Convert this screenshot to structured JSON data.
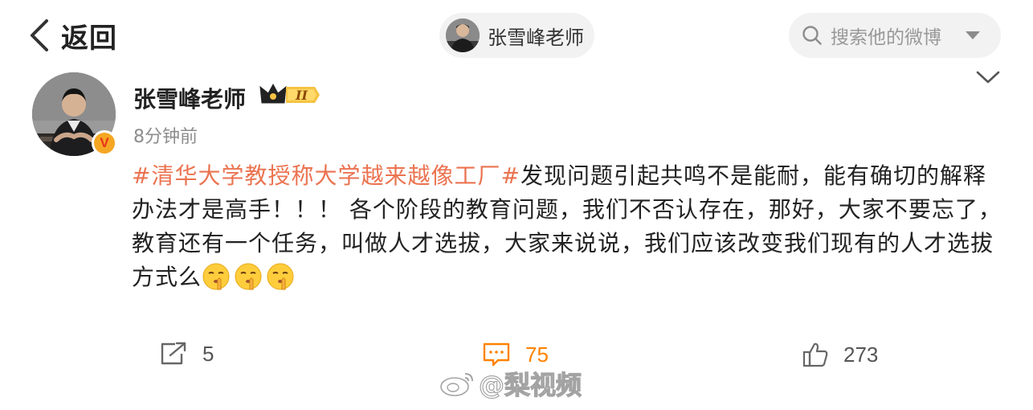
{
  "header": {
    "back_label": "返回",
    "user_pill_name": "张雪峰老师",
    "search_placeholder": "搜索他的微博"
  },
  "post": {
    "author": "张雪峰老师",
    "badge_level": "II",
    "verified_mark": "V",
    "timestamp": "8分钟前",
    "hashtag": "#清华大学教授称大学越来越像工厂#",
    "body": "发现问题引起共鸣不是能耐，能有确切的解释办法才是高手！！！ 各个阶段的教育问题，我们不否认存在，那好，大家不要忘了，教育还有一个任务，叫做人才选拔，大家来说说，我们应该改变我们现有的人才选拔方式么",
    "emoji": [
      "shush-emoji",
      "shush-emoji",
      "shush-emoji"
    ]
  },
  "actions": {
    "repost_count": "5",
    "comment_count": "75",
    "like_count": "273"
  },
  "watermark": "@梨视频",
  "colors": {
    "hashtag": "#eb7350",
    "comment_accent": "#ff8200",
    "verified_badge": "#f5a623",
    "pill_background": "#f2f2f2"
  }
}
